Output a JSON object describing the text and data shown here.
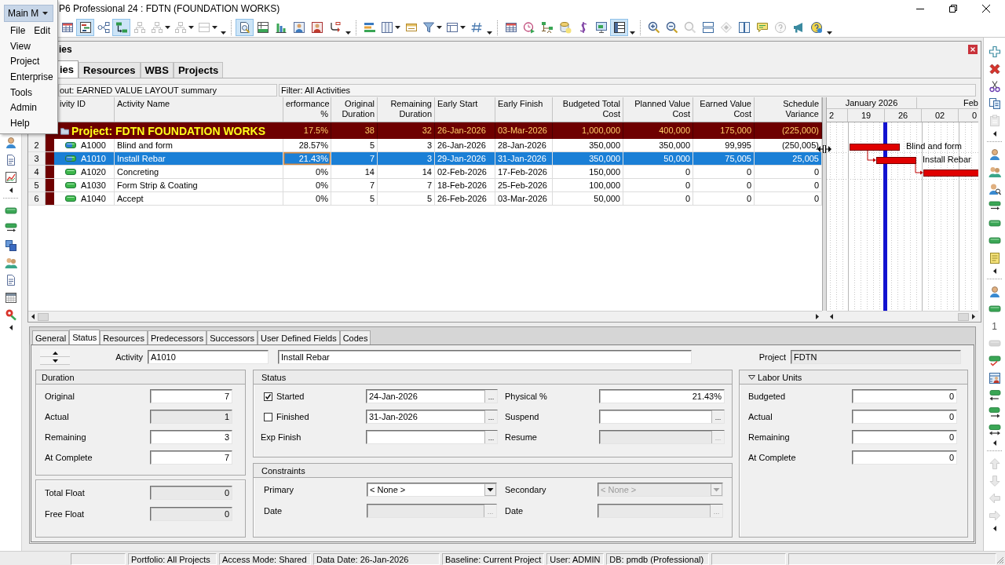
{
  "window": {
    "title": "P6 Professional 24 : FDTN (FOUNDATION WORKS)"
  },
  "main_menu": {
    "label": "Main M",
    "expanded": true,
    "rows": [
      [
        "File",
        "Edit"
      ],
      [
        "View"
      ],
      [
        "Project"
      ],
      [
        "Enterprise"
      ],
      [
        "Tools"
      ],
      [
        "Admin"
      ],
      [
        "Help"
      ]
    ]
  },
  "toolbar": [
    {
      "on": false,
      "disabled": false
    },
    {
      "on": true,
      "disabled": false
    },
    {
      "on": false,
      "disabled": false
    },
    {
      "on": true,
      "disabled": false
    },
    {
      "on": false,
      "disabled": true
    },
    {
      "on": false,
      "disabled": true
    },
    {
      "on": false,
      "disabled": true
    },
    {
      "on": false,
      "disabled": true
    },
    {
      "on": true,
      "disabled": false
    },
    {
      "on": false,
      "disabled": false
    },
    {
      "on": false,
      "disabled": false
    },
    {
      "on": false,
      "disabled": false
    },
    {
      "on": false,
      "disabled": false
    },
    {
      "on": false,
      "disabled": false
    },
    {
      "on": false,
      "disabled": false
    },
    {
      "on": false,
      "disabled": false
    },
    {
      "on": false,
      "disabled": false
    },
    {
      "on": false,
      "disabled": false
    },
    {
      "on": false,
      "disabled": false
    },
    {
      "on": false,
      "disabled": false
    },
    {
      "on": false,
      "disabled": false
    },
    {
      "on": false,
      "disabled": false
    },
    {
      "on": false,
      "disabled": false
    },
    {
      "on": false,
      "disabled": false
    },
    {
      "on": false,
      "disabled": false
    },
    {
      "on": false,
      "disabled": false
    },
    {
      "on": true,
      "disabled": false
    },
    {
      "on": false,
      "disabled": false
    },
    {
      "on": false,
      "disabled": false
    },
    {
      "on": false,
      "disabled": true
    },
    {
      "on": false,
      "disabled": false
    },
    {
      "on": false,
      "disabled": true
    },
    {
      "on": false,
      "disabled": false
    },
    {
      "on": false,
      "disabled": false
    },
    {
      "on": false,
      "disabled": true
    },
    {
      "on": false,
      "disabled": false
    },
    {
      "on": false,
      "disabled": false
    }
  ],
  "activities_panel": {
    "title": "ies",
    "tabs": [
      {
        "label": "ies",
        "selected": true
      },
      {
        "label": "Resources",
        "selected": false
      },
      {
        "label": "WBS",
        "selected": false
      },
      {
        "label": "Projects",
        "selected": false
      }
    ],
    "layout": "out: EARNED VALUE LAYOUT summary",
    "filter": "Filter: All Activities",
    "table": {
      "columns": [
        "ivity ID",
        "Activity Name",
        "erformance %",
        "Original Duration",
        "Remaining Duration",
        "Early Start",
        "Early Finish",
        "Budgeted Total Cost",
        "Planned Value Cost",
        "Earned Value Cost",
        "Schedule Variance"
      ],
      "project_row": {
        "cells": [
          "Project: FDTN FOUNDATION WORKS",
          "",
          "17.5%",
          "38",
          "32",
          "26-Jan-2026",
          "03-Mar-2026",
          "1,000,000",
          "400,000",
          "175,000",
          "(225,000)"
        ]
      },
      "rows": [
        {
          "number": "2",
          "started": true,
          "selected": false,
          "cells": [
            "A1000",
            "Blind and form",
            "28.57%",
            "5",
            "3",
            "26-Jan-2026",
            "28-Jan-2026",
            "350,000",
            "350,000",
            "99,995",
            "(250,005)"
          ]
        },
        {
          "number": "3",
          "started": true,
          "selected": true,
          "cells": [
            "A1010",
            "Install Rebar",
            "21.43%",
            "7",
            "3",
            "29-Jan-2026",
            "31-Jan-2026",
            "350,000",
            "50,000",
            "75,005",
            "25,005"
          ]
        },
        {
          "number": "4",
          "started": false,
          "selected": false,
          "cells": [
            "A1020",
            "Concreting",
            "0%",
            "14",
            "14",
            "02-Feb-2026",
            "17-Feb-2026",
            "150,000",
            "0",
            "0",
            "0"
          ]
        },
        {
          "number": "5",
          "started": false,
          "selected": false,
          "cells": [
            "A1030",
            "Form Strip & Coating",
            "0%",
            "7",
            "7",
            "18-Feb-2026",
            "25-Feb-2026",
            "100,000",
            "0",
            "0",
            "0"
          ]
        },
        {
          "number": "6",
          "started": false,
          "selected": false,
          "cells": [
            "A1040",
            "Accept",
            "0%",
            "5",
            "5",
            "26-Feb-2026",
            "03-Mar-2026",
            "50,000",
            "0",
            "0",
            "0"
          ]
        }
      ]
    },
    "gantt": {
      "months": [
        "January 2026",
        "Feb"
      ],
      "weeks": [
        "2",
        "19",
        "26",
        "02",
        "0"
      ],
      "bar_labels": [
        "Blind and form",
        "Install Rebar"
      ]
    }
  },
  "right_toolbar": [
    {
      "kind": "icon",
      "disabled": false
    },
    {
      "kind": "icon",
      "disabled": false
    },
    {
      "kind": "icon",
      "disabled": false
    },
    {
      "kind": "icon",
      "disabled": false
    },
    {
      "kind": "icon",
      "disabled": true
    },
    {
      "kind": "icon",
      "disabled": false
    },
    {
      "kind": "icon",
      "disabled": false
    },
    {
      "kind": "icon",
      "disabled": false
    },
    {
      "kind": "icon",
      "disabled": false
    },
    {
      "kind": "icon",
      "disabled": false
    },
    {
      "kind": "icon",
      "disabled": false
    },
    {
      "kind": "icon",
      "disabled": false
    },
    {
      "kind": "icon",
      "disabled": false
    },
    {
      "kind": "icon",
      "disabled": false
    },
    {
      "kind": "text",
      "label": "1",
      "disabled": false
    },
    {
      "kind": "icon",
      "disabled": true
    },
    {
      "kind": "icon",
      "disabled": false
    },
    {
      "kind": "icon",
      "disabled": false
    },
    {
      "kind": "icon",
      "disabled": false
    },
    {
      "kind": "icon",
      "disabled": false
    },
    {
      "kind": "icon",
      "disabled": false
    },
    {
      "kind": "icon",
      "disabled": true
    },
    {
      "kind": "icon",
      "disabled": true
    },
    {
      "kind": "icon",
      "disabled": true
    },
    {
      "kind": "icon",
      "disabled": true
    }
  ],
  "details": {
    "tabs": [
      {
        "label": "General",
        "selected": false
      },
      {
        "label": "Status",
        "selected": true
      },
      {
        "label": "Resources",
        "selected": false
      },
      {
        "label": "Predecessors",
        "selected": false
      },
      {
        "label": "Successors",
        "selected": false
      },
      {
        "label": "User Defined Fields",
        "selected": false
      },
      {
        "label": "Codes",
        "selected": false
      }
    ],
    "activity": {
      "label": "Activity",
      "id": "A1010",
      "name": "Install Rebar"
    },
    "project": {
      "label": "Project",
      "value": "FDTN",
      "disabled": true
    },
    "duration": {
      "title": "Duration",
      "fields": [
        {
          "label": "Original",
          "value": "7",
          "disabled": false
        },
        {
          "label": "Actual",
          "value": "1",
          "disabled": true
        },
        {
          "label": "Remaining",
          "value": "3",
          "disabled": false
        },
        {
          "label": "At Complete",
          "value": "7",
          "disabled": false
        }
      ]
    },
    "float": {
      "fields": [
        {
          "label": "Total Float",
          "value": "0",
          "disabled": true
        },
        {
          "label": "Free Float",
          "value": "0",
          "disabled": true
        }
      ]
    },
    "status": {
      "title": "Status",
      "left": [
        {
          "kind": "check",
          "label": "Started",
          "checked": true,
          "value": "24-Jan-2026",
          "button": "...",
          "disabled": false
        },
        {
          "kind": "check",
          "label": "Finished",
          "checked": false,
          "value": "31-Jan-2026",
          "button": "...",
          "disabled": false
        },
        {
          "kind": "label",
          "label": "Exp Finish",
          "button": "...",
          "disabled": false
        }
      ],
      "right": [
        {
          "label": "Physical %",
          "value": "21.43%",
          "disabled": false
        },
        {
          "label": "Suspend",
          "button": "...",
          "disabled": false
        },
        {
          "label": "Resume",
          "button": "...",
          "disabled": true
        }
      ]
    },
    "constraints": {
      "title": "Constraints",
      "left": [
        {
          "kind": "select",
          "label": "Primary",
          "value": "< None >",
          "disabled": false
        },
        {
          "kind": "date",
          "label": "Date",
          "button": "...",
          "disabled": true
        }
      ],
      "right": [
        {
          "kind": "select",
          "label": "Secondary",
          "value": "< None >",
          "disabled": true
        },
        {
          "kind": "date",
          "label": "Date",
          "button": "...",
          "disabled": true
        }
      ]
    },
    "labor_units": {
      "title": "Labor Units",
      "expanded": true,
      "fields": [
        {
          "label": "Budgeted",
          "value": "0"
        },
        {
          "label": "Actual",
          "value": "0"
        },
        {
          "label": "Remaining",
          "value": "0"
        },
        {
          "label": "At Complete",
          "value": "0"
        }
      ]
    }
  },
  "status_bar": [
    "Portfolio: All Projects",
    "Access Mode: Shared",
    "Data Date: 26-Jan-2026",
    "Baseline: Current Project",
    "User: ADMIN",
    "DB: pmdb (Professional)"
  ]
}
